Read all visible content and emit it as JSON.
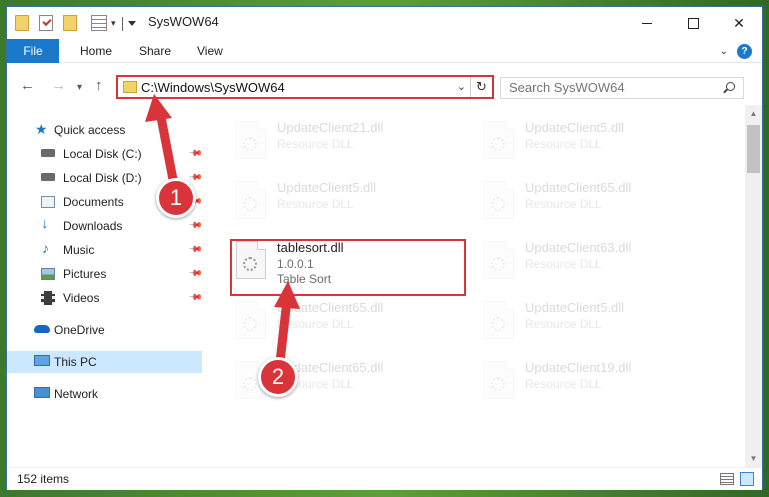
{
  "window": {
    "title": "SysWOW64"
  },
  "ribbon": {
    "tabs": [
      "File",
      "Home",
      "Share",
      "View"
    ]
  },
  "nav": {
    "address": "C:\\Windows\\SysWOW64",
    "search_placeholder": "Search SysWOW64"
  },
  "sidebar": {
    "items": [
      {
        "label": "Quick access",
        "icon": "star-icon"
      },
      {
        "label": "Local Disk (C:)",
        "icon": "drive-icon"
      },
      {
        "label": "Local Disk (D:)",
        "icon": "drive-icon"
      },
      {
        "label": "Documents",
        "icon": "documents-icon"
      },
      {
        "label": "Downloads",
        "icon": "download-icon"
      },
      {
        "label": "Music",
        "icon": "music-icon"
      },
      {
        "label": "Pictures",
        "icon": "pictures-icon"
      },
      {
        "label": "Videos",
        "icon": "videos-icon"
      },
      {
        "label": "OneDrive",
        "icon": "cloud-icon"
      },
      {
        "label": "This PC",
        "icon": "computer-icon"
      },
      {
        "label": "Network",
        "icon": "network-icon"
      }
    ]
  },
  "files": {
    "left": [
      {
        "name": "UpdateClient21.dll",
        "line1": "Resource DLL",
        "line2": ""
      },
      {
        "name": "UpdateClient5.dll",
        "line1": "Resource DLL",
        "line2": ""
      },
      {
        "name": "tablesort.dll",
        "line1": "1.0.0.1",
        "line2": "Table Sort"
      },
      {
        "name": "UpdateClient65.dll",
        "line1": "Resource DLL",
        "line2": ""
      },
      {
        "name": "UpdateClient65.dll",
        "line1": "Resource DLL",
        "line2": ""
      }
    ],
    "right": [
      {
        "name": "UpdateClient5.dll",
        "line1": "Resource DLL"
      },
      {
        "name": "UpdateClient65.dll",
        "line1": "Resource DLL"
      },
      {
        "name": "UpdateClient63.dll",
        "line1": "Resource DLL"
      },
      {
        "name": "UpdateClient5.dll",
        "line1": "Resource DLL"
      },
      {
        "name": "UpdateClient19.dll",
        "line1": "Resource DLL"
      }
    ]
  },
  "status": {
    "count": "152 items"
  },
  "annotations": {
    "step1": "1",
    "step2": "2"
  },
  "colors": {
    "accent": "#1979ca",
    "highlight": "#d9343a",
    "selected": "#cce8ff"
  }
}
